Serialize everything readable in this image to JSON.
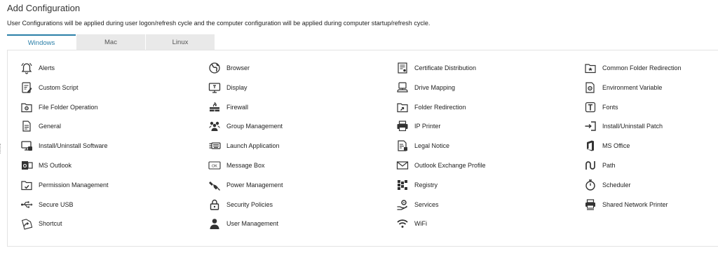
{
  "header": {
    "title": "Add Configuration",
    "subtitle": "User Configurations will be applied during user logon/refresh cycle and the computer configuration will be applied during computer startup/refresh cycle."
  },
  "tabs": [
    {
      "label": "Windows",
      "active": true
    },
    {
      "label": "Mac",
      "active": false
    },
    {
      "label": "Linux",
      "active": false
    }
  ],
  "accent_color": "#2a7fa8",
  "columns": [
    [
      {
        "label": "Alerts",
        "icon": "bell-icon"
      },
      {
        "label": "Custom Script",
        "icon": "script-icon"
      },
      {
        "label": "File Folder Operation",
        "icon": "folder-gear-icon"
      },
      {
        "label": "General",
        "icon": "document-icon"
      },
      {
        "label": "Install/Uninstall Software",
        "icon": "monitor-software-icon"
      },
      {
        "label": "MS Outlook",
        "icon": "outlook-icon"
      },
      {
        "label": "Permission Management",
        "icon": "folder-check-icon"
      },
      {
        "label": "Secure USB",
        "icon": "usb-icon"
      },
      {
        "label": "Shortcut",
        "icon": "shortcut-icon"
      }
    ],
    [
      {
        "label": "Browser",
        "icon": "globe-icon"
      },
      {
        "label": "Display",
        "icon": "display-icon"
      },
      {
        "label": "Firewall",
        "icon": "firewall-icon"
      },
      {
        "label": "Group Management",
        "icon": "group-icon"
      },
      {
        "label": "Launch Application",
        "icon": "keyboard-icon"
      },
      {
        "label": "Message Box",
        "icon": "message-box-icon"
      },
      {
        "label": "Power Management",
        "icon": "plug-icon"
      },
      {
        "label": "Security Policies",
        "icon": "lock-icon"
      },
      {
        "label": "User Management",
        "icon": "user-icon"
      }
    ],
    [
      {
        "label": "Certificate Distribution",
        "icon": "certificate-icon"
      },
      {
        "label": "Drive Mapping",
        "icon": "drive-icon"
      },
      {
        "label": "Folder Redirection",
        "icon": "folder-arrow-icon"
      },
      {
        "label": "IP Printer",
        "icon": "printer-icon"
      },
      {
        "label": "Legal Notice",
        "icon": "legal-notice-icon"
      },
      {
        "label": "Outlook Exchange Profile",
        "icon": "mail-icon"
      },
      {
        "label": "Registry",
        "icon": "registry-icon"
      },
      {
        "label": "Services",
        "icon": "services-icon"
      },
      {
        "label": "WiFi",
        "icon": "wifi-icon"
      }
    ],
    [
      {
        "label": "Common Folder Redirection",
        "icon": "folder-star-icon"
      },
      {
        "label": "Environment Variable",
        "icon": "environment-icon"
      },
      {
        "label": "Fonts",
        "icon": "font-icon"
      },
      {
        "label": "Install/Uninstall Patch",
        "icon": "patch-icon"
      },
      {
        "label": "MS Office",
        "icon": "office-icon"
      },
      {
        "label": "Path",
        "icon": "path-icon"
      },
      {
        "label": "Scheduler",
        "icon": "stopwatch-icon"
      },
      {
        "label": "Shared Network Printer",
        "icon": "network-printer-icon"
      }
    ]
  ]
}
